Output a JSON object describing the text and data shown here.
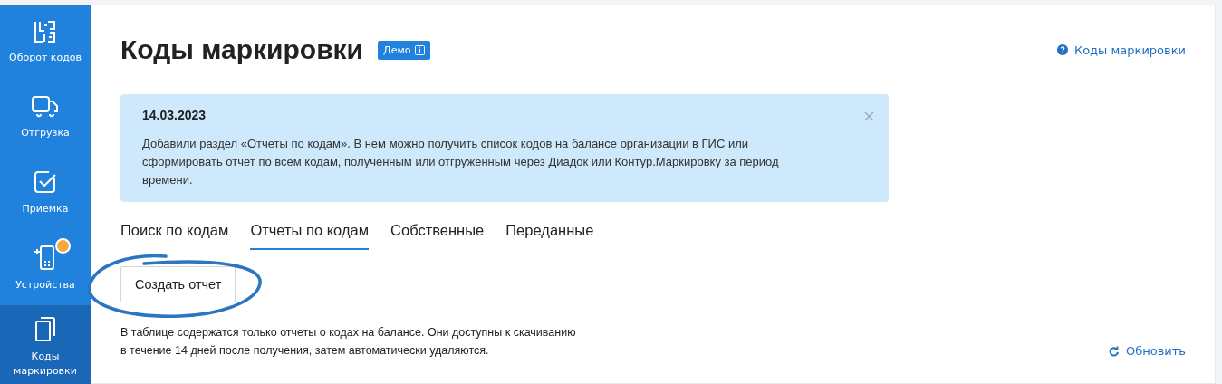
{
  "sidebar": {
    "items": [
      {
        "label": "Оборот кодов",
        "selected": false,
        "notification": false
      },
      {
        "label": "Отгрузка",
        "selected": false,
        "notification": false
      },
      {
        "label": "Приемка",
        "selected": false,
        "notification": false
      },
      {
        "label": "Устройства",
        "selected": false,
        "notification": true
      },
      {
        "label": "Коды маркировки",
        "selected": true,
        "notification": false
      }
    ]
  },
  "header": {
    "title": "Коды маркировки",
    "badge": "Демо",
    "help_link": "Коды маркировки"
  },
  "notice": {
    "date": "14.03.2023",
    "text": "Добавили раздел «Отчеты по кодам». В нем можно получить список кодов на балансе организации в ГИС или сформировать отчет по всем кодам, полученным или отгруженным через Диадок или Контур.Маркировку за период времени."
  },
  "tabs": [
    {
      "label": "Поиск по кодам",
      "selected": false
    },
    {
      "label": "Отчеты по кодам",
      "selected": true
    },
    {
      "label": "Собственные",
      "selected": false
    },
    {
      "label": "Переданные",
      "selected": false
    }
  ],
  "create_button": "Создать отчет",
  "info_text": "В таблице содержатся только отчеты о кодах на балансе. Они доступны к скачиванию\nв течение 14 дней после получения, затем автоматически удаляются.",
  "refresh_link": "Обновить"
}
